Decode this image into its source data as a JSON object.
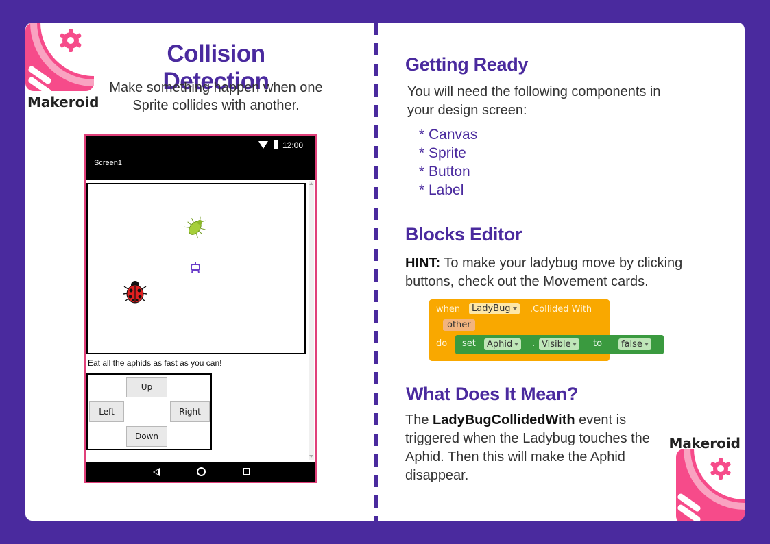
{
  "brand": {
    "name": "Makeroid",
    "colors": {
      "pink": "#f64b8a",
      "purple": "#4a2a9e"
    }
  },
  "left": {
    "title": "Collision Detection",
    "subtitle": "Make something happen when one Sprite collides with another."
  },
  "phone": {
    "time": "12:00",
    "screen_title": "Screen1",
    "message": "Eat all the aphids as fast as you can!",
    "buttons": {
      "up": "Up",
      "left": "Left",
      "right": "Right",
      "down": "Down"
    },
    "icons": [
      "wifi-icon",
      "battery-icon",
      "back-icon",
      "home-icon",
      "recent-apps-icon"
    ]
  },
  "getting_ready": {
    "heading": "Getting Ready",
    "text": "You will need the following components in your design screen:",
    "items": [
      "* Canvas",
      "* Sprite",
      "* Button",
      "* Label"
    ]
  },
  "blocks_editor": {
    "heading": "Blocks Editor",
    "hint_label": "HINT:",
    "hint_text": "To make your ladybug move by clicking buttons, check out the Movement cards.",
    "block": {
      "when": "when",
      "component": "LadyBug",
      "event": ".Collided With",
      "param": "other",
      "do": "do",
      "set": "set",
      "target": "Aphid",
      "dot": ".",
      "property": "Visible",
      "to": "to",
      "value": "false"
    }
  },
  "what_does_it_mean": {
    "heading": "What Does It Mean?",
    "pre": "The ",
    "event_name": "LadyBugCollidedWith",
    "post": " event is triggered when the Ladybug touches the Aphid. Then this will make the Aphid disappear."
  }
}
